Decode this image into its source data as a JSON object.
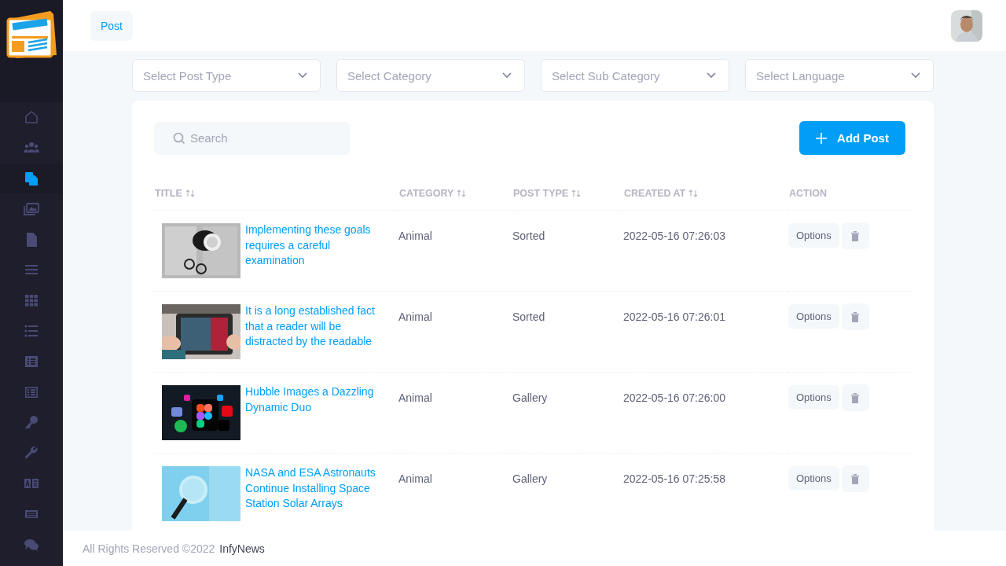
{
  "sidebar": {
    "items": [
      {
        "kind": "home",
        "selected": false
      },
      {
        "kind": "users",
        "selected": false
      },
      {
        "kind": "copy",
        "selected": true
      },
      {
        "kind": "images",
        "selected": false
      },
      {
        "kind": "file",
        "selected": false
      },
      {
        "kind": "bars",
        "selected": false
      },
      {
        "kind": "grid",
        "selected": false
      },
      {
        "kind": "list",
        "selected": false
      },
      {
        "kind": "listbox",
        "selected": false
      },
      {
        "kind": "listoutline",
        "selected": false
      },
      {
        "kind": "key",
        "selected": false
      },
      {
        "kind": "wrench",
        "selected": false
      },
      {
        "kind": "language",
        "selected": false
      },
      {
        "kind": "card",
        "selected": false
      },
      {
        "kind": "comments",
        "selected": false
      }
    ]
  },
  "header": {
    "tab": "Post"
  },
  "filters": [
    {
      "placeholder": "Select Post Type"
    },
    {
      "placeholder": "Select Category"
    },
    {
      "placeholder": "Select Sub Category"
    },
    {
      "placeholder": "Select Language"
    }
  ],
  "search": {
    "placeholder": "Search"
  },
  "add_button": "Add Post",
  "table": {
    "columns": [
      {
        "label": "TITLE",
        "sortable": true
      },
      {
        "label": "CATEGORY",
        "sortable": true
      },
      {
        "label": "POST TYPE",
        "sortable": true
      },
      {
        "label": "CREATED AT",
        "sortable": true
      },
      {
        "label": "ACTION",
        "sortable": false
      }
    ],
    "rows": [
      {
        "title": "Implementing these goals requires a careful examination",
        "category": "Animal",
        "post_type": "Sorted",
        "created_at": "2022-05-16 07:26:03",
        "options": "Options"
      },
      {
        "title": "It is a long established fact that a reader will be distracted by the readable",
        "category": "Animal",
        "post_type": "Sorted",
        "created_at": "2022-05-16 07:26:01",
        "options": "Options"
      },
      {
        "title": "Hubble Images a Dazzling Dynamic Duo",
        "category": "Animal",
        "post_type": "Gallery",
        "created_at": "2022-05-16 07:26:00",
        "options": "Options"
      },
      {
        "title": "NASA and ESA Astronauts Continue Installing Space Station Solar Arrays",
        "category": "Animal",
        "post_type": "Gallery",
        "created_at": "2022-05-16 07:25:58",
        "options": "Options"
      }
    ]
  },
  "footer": {
    "copyright": "All Rights Reserved ©2022",
    "brand": "InfyNews"
  }
}
